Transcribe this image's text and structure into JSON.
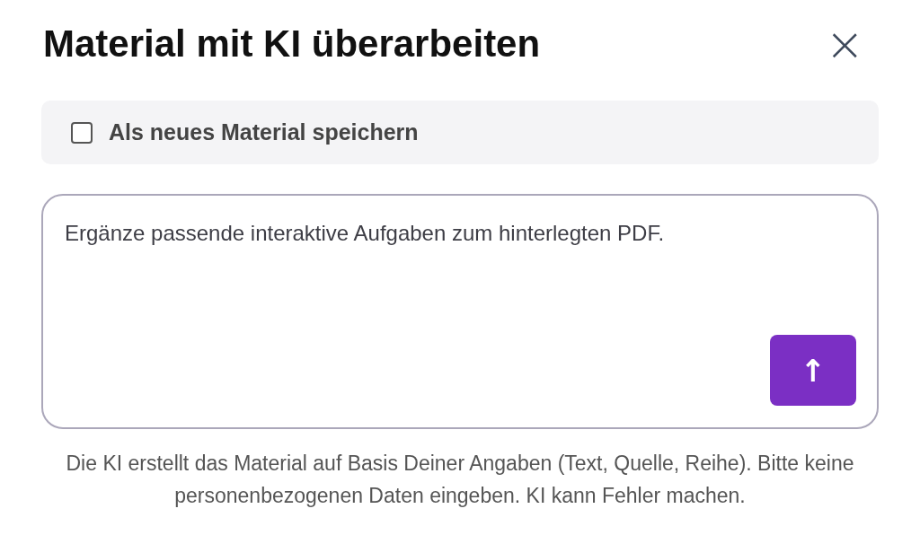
{
  "dialog": {
    "title": "Material mit KI überarbeiten",
    "close": "×"
  },
  "save_as_new": {
    "label": "Als neues Material speichern",
    "checked": false
  },
  "prompt": {
    "value": "Ergänze passende interaktive Aufgaben zum hinterlegten PDF."
  },
  "send_button": {
    "icon": "↑"
  },
  "disclaimer": "Die KI erstellt das Material auf Basis Deiner Angaben (Text, Quelle, Reihe). Bitte keine personenbezogenen Daten eingeben. KI kann Fehler machen."
}
